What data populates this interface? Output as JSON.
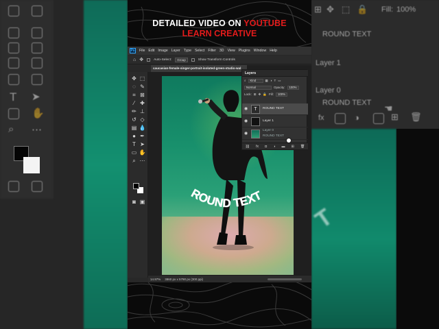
{
  "headline": {
    "line1_prefix": "DETAILED VIDEO ON",
    "line1_highlight": "YOUTUBE",
    "line2": "LEARN CREATIVE"
  },
  "colors": {
    "accent_red": "#e31b1b",
    "canvas_green": "#139070",
    "ui_dark": "#282828"
  },
  "menu": [
    "File",
    "Edit",
    "Image",
    "Layer",
    "Type",
    "Select",
    "Filter",
    "3D",
    "View",
    "Plugins",
    "Window",
    "Help"
  ],
  "options_bar": {
    "auto_select": "Auto-Select:",
    "group_value": "Group",
    "transform_controls": "Show Transform Controls"
  },
  "document_tab": "caucasian-female-singer-portrait-isolated-green-studio-wal",
  "canvas_text": "ROUND TEXT",
  "status": {
    "zoom": "14.97%",
    "dims": "3860 px x 5790 px (300 ppi)"
  },
  "layers_panel": {
    "title": "Layers",
    "filter": "Kind",
    "blend_mode": "Normal",
    "opacity_label": "Opacity:",
    "opacity_value": "100%",
    "lock_label": "Lock:",
    "fill_label": "Fill:",
    "fill_value": "100%",
    "layers": [
      {
        "name": "ROUND TEXT",
        "type": "text",
        "selected": true
      },
      {
        "name": "Layer 1",
        "type": "mask",
        "selected": false
      },
      {
        "name": "Layer 0",
        "type": "photo",
        "selected": false,
        "ghost": "ROUND TEXT"
      }
    ]
  },
  "ghost_right": {
    "fill_label": "Fill:",
    "fill_value": "100%",
    "round_text": "ROUND TEXT",
    "layer1": "Layer 1",
    "layer0": "Layer 0",
    "ghost_text": "ROUND TEXT",
    "fx": "fx"
  }
}
